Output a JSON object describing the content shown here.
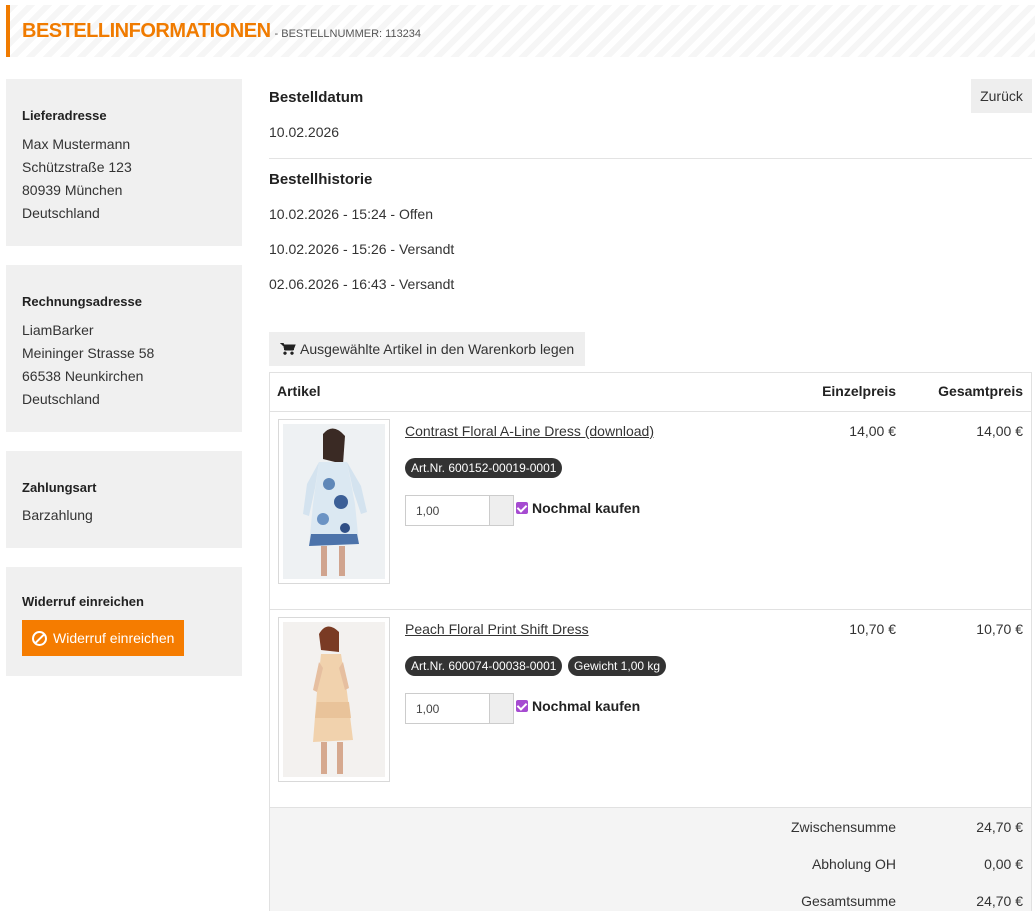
{
  "header": {
    "title": "BESTELLINFORMATIONEN",
    "subtitle": "- BESTELLNUMMER: 113234"
  },
  "sidebar": {
    "delivery": {
      "heading": "Lieferadresse",
      "lines": [
        "Max Mustermann",
        "Schützstraße 123",
        "80939 München",
        "Deutschland"
      ]
    },
    "billing": {
      "heading": "Rechnungsadresse",
      "lines": [
        "LiamBarker",
        "Meininger Strasse 58",
        "66538 Neunkirchen",
        "Deutschland"
      ]
    },
    "payment": {
      "heading": "Zahlungsart",
      "value": "Barzahlung"
    },
    "withdrawal": {
      "heading": "Widerruf einreichen",
      "button_label": "Widerruf einreichen",
      "button_color": "#f57c00"
    }
  },
  "back_button": "Zurück",
  "order_date": {
    "label": "Bestelldatum",
    "value": "10.02.2026"
  },
  "history": {
    "label": "Bestellhistorie",
    "entries": [
      "10.02.2026 - 15:24 - Offen",
      "10.02.2026 - 15:26 - Versandt",
      "02.06.2026 - 16:43 - Versandt"
    ]
  },
  "add_to_cart_button": "Ausgewählte Artikel in den Warenkorb legen",
  "table": {
    "headers": {
      "article": "Artikel",
      "unit_price": "Einzelpreis",
      "total_price": "Gesamtpreis"
    },
    "items": [
      {
        "name": "Contrast Floral A-Line Dress (download)",
        "badges": [
          "Art.Nr. 600152-00019-0001"
        ],
        "quantity": "1,00",
        "buy_again": "Nochmal kaufen",
        "unit_price": "14,00 €",
        "total_price": "14,00 €"
      },
      {
        "name": "Peach Floral Print Shift Dress",
        "badges": [
          "Art.Nr. 600074-00038-0001",
          "Gewicht 1,00 kg"
        ],
        "quantity": "1,00",
        "buy_again": "Nochmal kaufen",
        "unit_price": "10,70 €",
        "total_price": "10,70 €"
      }
    ],
    "summary": [
      {
        "label": "Zwischensumme",
        "value": "24,70 €"
      },
      {
        "label": "Abholung OH",
        "value": "0,00 €"
      },
      {
        "label": "Gesamtsumme",
        "value": "24,70 €"
      }
    ]
  },
  "colors": {
    "accent": "#f07b00",
    "checkbox": "#a64bd1",
    "badge": "#333333"
  }
}
